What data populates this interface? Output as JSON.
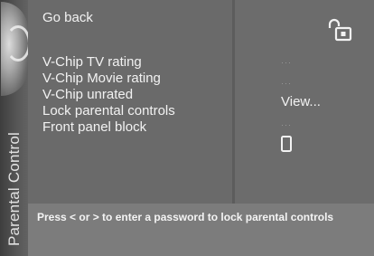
{
  "side": {
    "title": "Parental Control"
  },
  "menu": {
    "items": [
      {
        "label": "Go back"
      },
      {
        "label": "V-Chip TV rating"
      },
      {
        "label": "V-Chip Movie rating"
      },
      {
        "label": "V-Chip unrated"
      },
      {
        "label": "Lock parental controls"
      },
      {
        "label": "Front panel block"
      }
    ]
  },
  "values": {
    "unrated_value": "View..."
  },
  "hint": {
    "text": "Press < or > to enter a password to lock parental controls"
  },
  "icons": {
    "lock": "unlocked-padlock-icon",
    "front_panel": "front-panel-device-icon"
  }
}
